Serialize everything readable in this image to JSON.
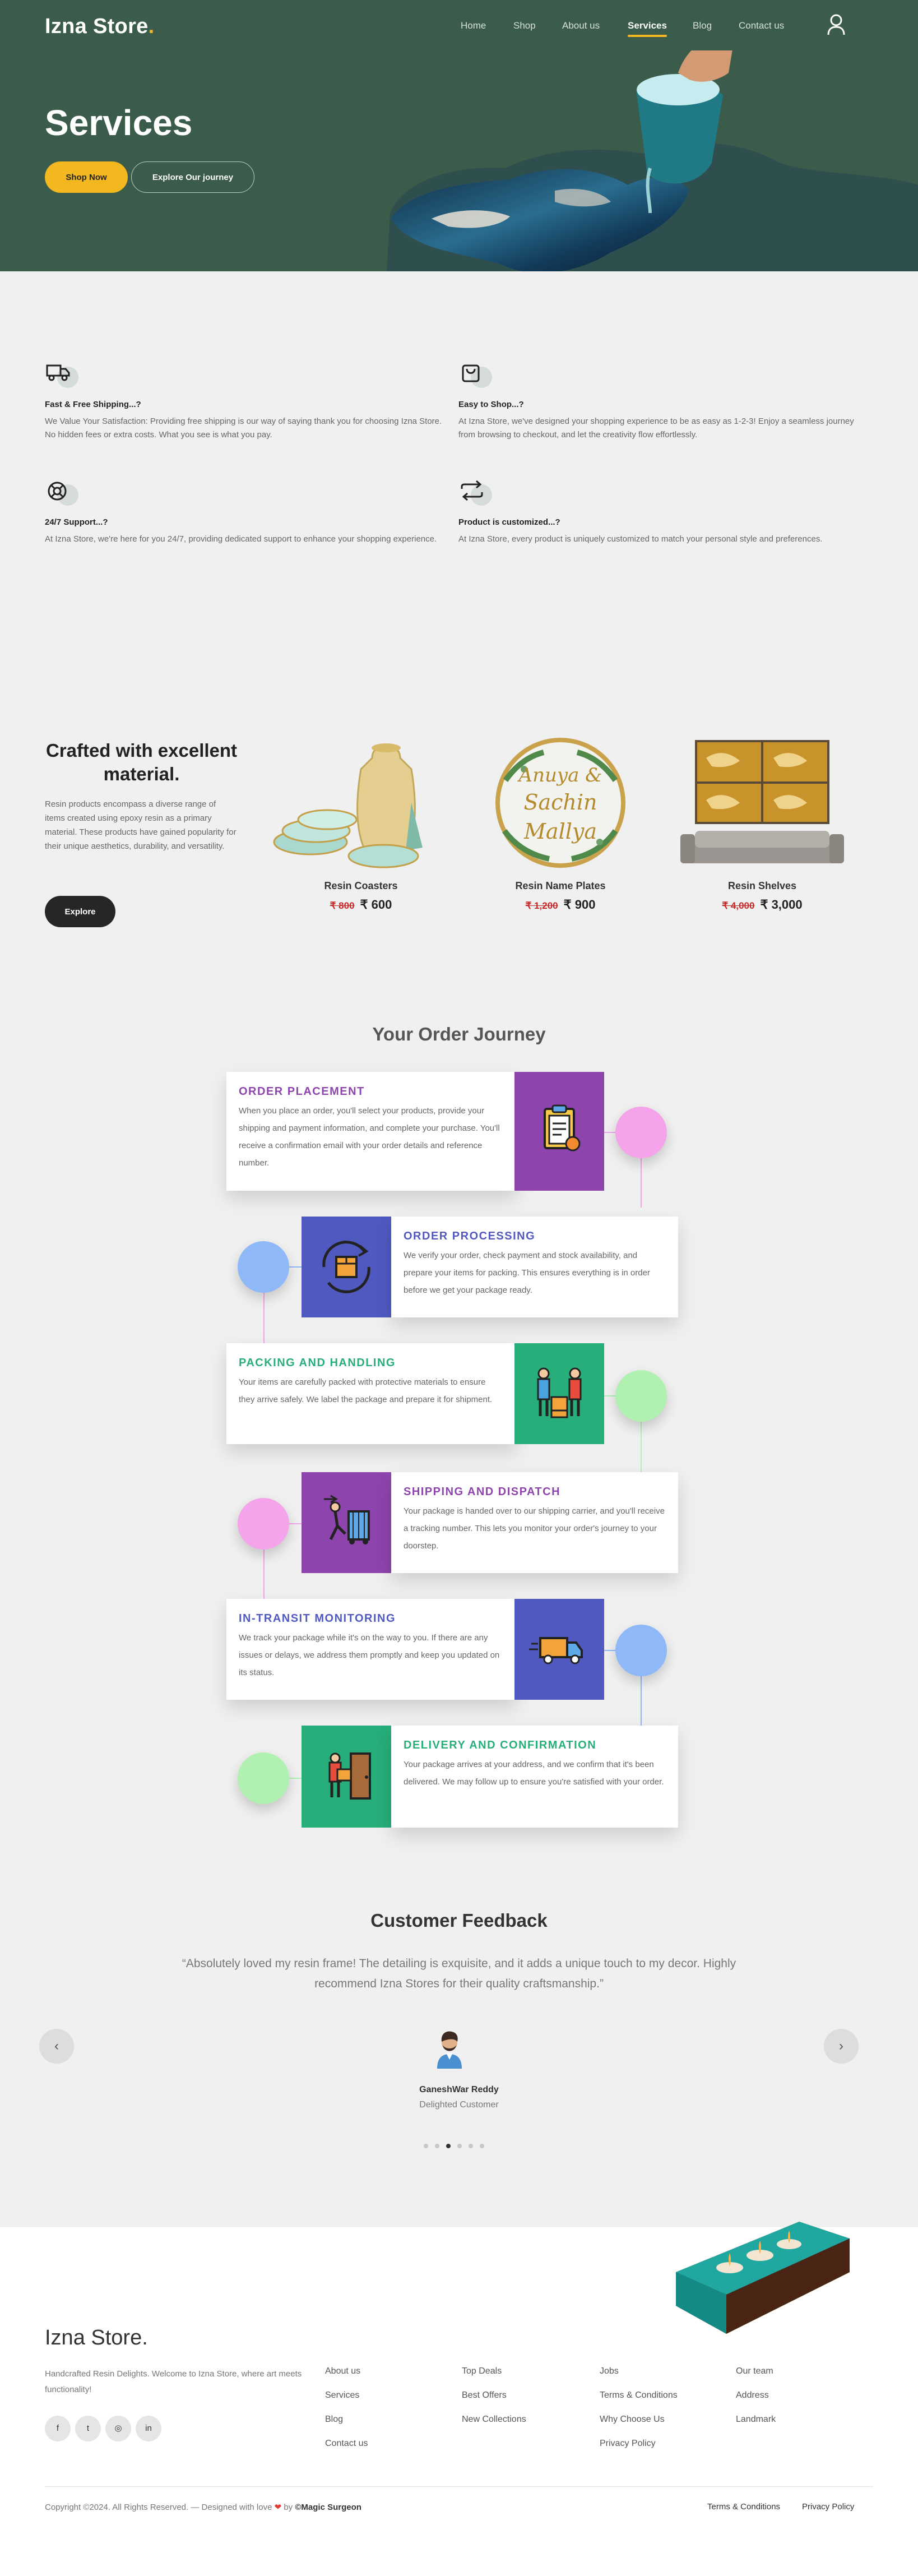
{
  "header": {
    "logo": "Izna Store",
    "logo_dot": ".",
    "nav": [
      "Home",
      "Shop",
      "About us",
      "Services",
      "Blog",
      "Contact us"
    ],
    "active_nav": "Services"
  },
  "hero": {
    "title": "Services",
    "primary_button": "Shop Now",
    "secondary_button": "Explore Our journey"
  },
  "features": [
    {
      "icon": "truck-icon",
      "title": "Fast & Free Shipping...?",
      "text": "We Value Your Satisfaction: Providing free shipping is our way of saying thank you for choosing Izna Store. No hidden fees or extra costs. What you see is what you pay."
    },
    {
      "icon": "shopping-bag-icon",
      "title": "Easy to Shop...?",
      "text": "At Izna Store, we've designed your shopping experience to be as easy as 1-2-3! Enjoy a seamless journey from browsing to checkout, and let the creativity flow effortlessly."
    },
    {
      "icon": "lifebuoy-icon",
      "title": "24/7 Support...?",
      "text": "At Izna Store, we're here for you 24/7, providing dedicated support to enhance your shopping experience."
    },
    {
      "icon": "repeat-icon",
      "title": "Product is customized...?",
      "text": "At Izna Store, every product is uniquely customized to match your personal style and preferences."
    }
  ],
  "crafted": {
    "title": "Crafted with excellent material.",
    "text": "Resin products encompass a diverse range of items created using epoxy resin as a primary material. These products have gained popularity for their unique aesthetics, durability, and versatility.",
    "button": "Explore"
  },
  "products": [
    {
      "name": "Resin Coasters",
      "old_price": "₹ 800",
      "price": "₹ 600"
    },
    {
      "name": "Resin Name Plates",
      "old_price": "₹ 1,200",
      "price": "₹ 900",
      "plate_text": [
        "Anuya &",
        "Sachin",
        "Mallya"
      ]
    },
    {
      "name": "Resin Shelves",
      "old_price": "₹ 4,000",
      "price": "₹ 3,000"
    }
  ],
  "journey": {
    "title": "Your Order Journey",
    "steps": [
      {
        "title": "ORDER PLACEMENT",
        "text": "When you place an order, you'll select your products, provide your shipping and payment information, and complete your purchase. You'll receive a confirmation email with your order details and reference number.",
        "color": "#8e44ad",
        "circle": "#f5a3ea"
      },
      {
        "title": "ORDER PROCESSING",
        "text": "We verify your order, check payment and stock availability, and prepare your items for packing. This ensures everything is in order before we get your package ready.",
        "color": "#5059c0",
        "circle": "#8eb8f8"
      },
      {
        "title": "PACKING AND HANDLING",
        "text": "Your items are carefully packed with protective materials to ensure they arrive safely. We label the package and prepare it for shipment.",
        "color": "#27ae7a",
        "circle": "#b0f0b0"
      },
      {
        "title": "SHIPPING AND DISPATCH",
        "text": "Your package is handed over to our shipping carrier, and you'll receive a tracking number. This lets you monitor your order's journey to your doorstep.",
        "color": "#8e44ad",
        "circle": "#f5a3ea"
      },
      {
        "title": "IN-TRANSIT MONITORING",
        "text": "We track your package while it's on the way to you. If there are any issues or delays, we address them promptly and keep you updated on its status.",
        "color": "#5059c0",
        "circle": "#8eb8f8"
      },
      {
        "title": "DELIVERY AND CONFIRMATION",
        "text": "Your package arrives at your address, and we confirm that it's been delivered. We may follow up to ensure you're satisfied with your order.",
        "color": "#27ae7a",
        "circle": "#b0f0b0"
      }
    ]
  },
  "feedback": {
    "title": "Customer Feedback",
    "quote": "“Absolutely loved my resin frame! The detailing is exquisite, and it adds a unique touch to my decor. Highly recommend Izna Stores for their quality craftsmanship.”",
    "name": "GaneshWar Reddy",
    "role": "Delighted Customer",
    "prev": "‹",
    "next": "›",
    "active_slide": 3,
    "total_slides": 6
  },
  "footer": {
    "logo": "Izna Store.",
    "about": "Handcrafted Resin Delights. Welcome to Izna Store, where art meets functionality!",
    "socials": [
      {
        "icon": "facebook-icon",
        "glyph": "f"
      },
      {
        "icon": "twitter-icon",
        "glyph": "t"
      },
      {
        "icon": "instagram-icon",
        "glyph": "◎"
      },
      {
        "icon": "linkedin-icon",
        "glyph": "in"
      }
    ],
    "columns": [
      [
        "About us",
        "Services",
        "Blog",
        "Contact us"
      ],
      [
        "Top Deals",
        "Best Offers",
        "New Collections"
      ],
      [
        "Jobs",
        "Terms & Conditions",
        "Why Choose Us",
        "Privacy Policy"
      ],
      [
        "Our team",
        "Address",
        "Landmark"
      ]
    ],
    "copyright_pre": "Copyright ©2024. All Rights Reserved. — Designed with love",
    "copyright_by": "by",
    "credit": "©Magic Surgeon",
    "legal": [
      "Terms & Conditions",
      "Privacy Policy"
    ]
  }
}
